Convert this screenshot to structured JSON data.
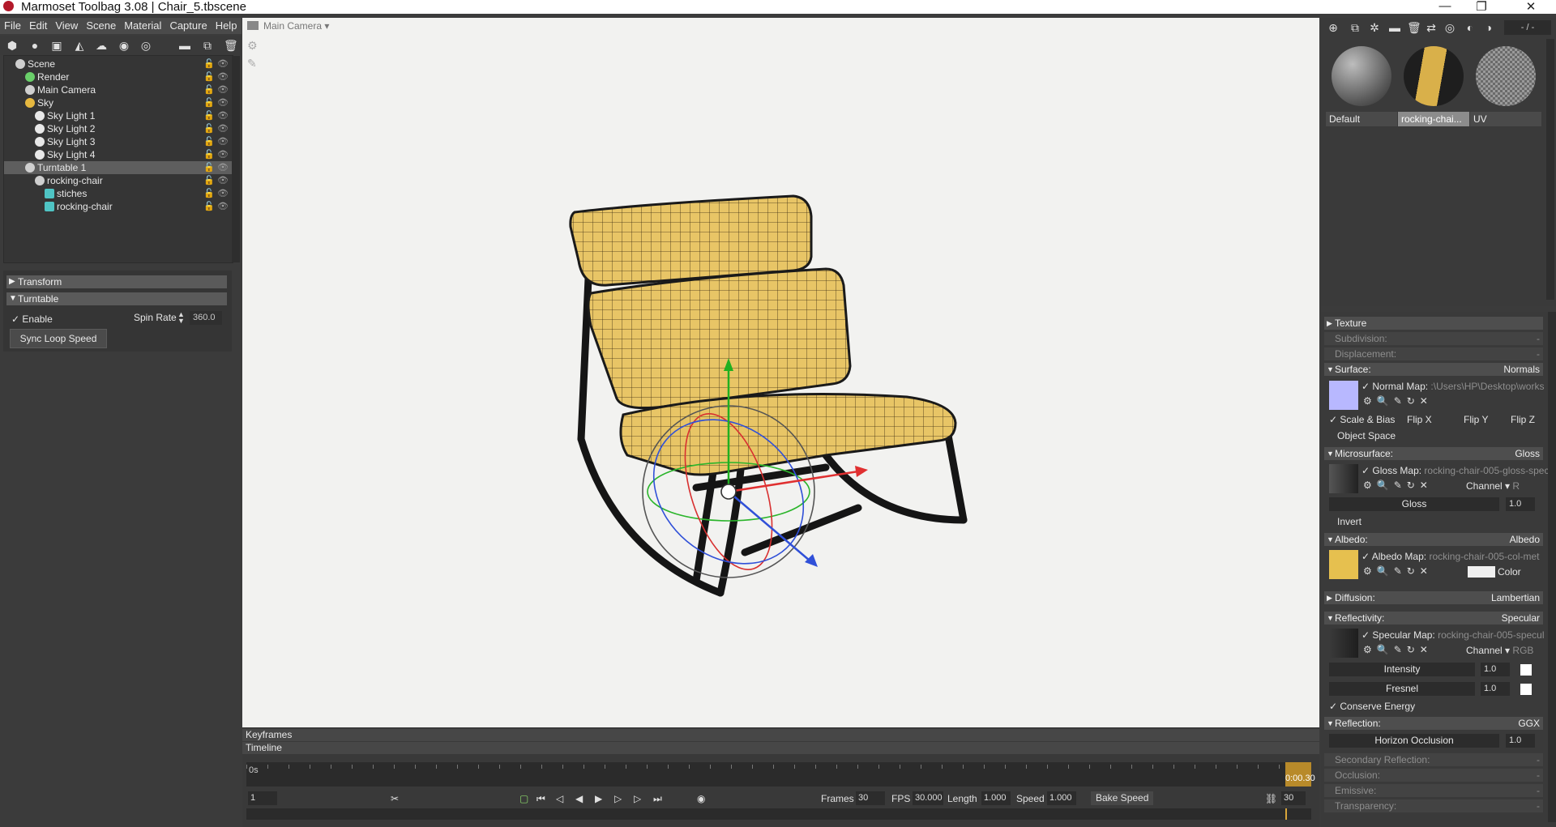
{
  "window": {
    "title": "Marmoset Toolbag 3.08  |  Chair_5.tbscene",
    "controls": [
      "—",
      "❐",
      "✕"
    ]
  },
  "menu": [
    "File",
    "Edit",
    "View",
    "Scene",
    "Material",
    "Capture",
    "Help"
  ],
  "scene_tree": [
    {
      "label": "Scene",
      "depth": 0,
      "icon": "scene-icon",
      "selected": false
    },
    {
      "label": "Render",
      "depth": 1,
      "icon": "render-icon",
      "selected": false
    },
    {
      "label": "Main Camera",
      "depth": 1,
      "icon": "camera-icon",
      "selected": false
    },
    {
      "label": "Sky",
      "depth": 1,
      "icon": "sky-icon",
      "selected": false
    },
    {
      "label": "Sky Light 1",
      "depth": 2,
      "icon": "light-icon",
      "selected": false
    },
    {
      "label": "Sky Light 2",
      "depth": 2,
      "icon": "light-icon",
      "selected": false
    },
    {
      "label": "Sky Light 3",
      "depth": 2,
      "icon": "light-icon",
      "selected": false
    },
    {
      "label": "Sky Light 4",
      "depth": 2,
      "icon": "light-icon",
      "selected": false
    },
    {
      "label": "Turntable 1",
      "depth": 1,
      "icon": "turntable-icon",
      "selected": true
    },
    {
      "label": "rocking-chair",
      "depth": 2,
      "icon": "object-icon",
      "selected": false
    },
    {
      "label": "stiches",
      "depth": 3,
      "icon": "mesh-icon",
      "selected": false
    },
    {
      "label": "rocking-chair",
      "depth": 3,
      "icon": "mesh-icon",
      "selected": false
    }
  ],
  "left_props": {
    "transform_label": "Transform",
    "turntable_label": "Turntable",
    "enable_label": "Enable",
    "enable_checked": true,
    "spin_rate_label": "Spin Rate",
    "spin_rate_value": "360.0",
    "sync_button": "Sync Loop Speed"
  },
  "viewport": {
    "camera_label": "Main Camera",
    "background": "#f2f2f0"
  },
  "timeline": {
    "keyframes_label": "Keyframes",
    "timeline_label": "Timeline",
    "start_label": "0s",
    "end_label": "0:00.30",
    "current_frame": "1",
    "frames_label": "Frames",
    "frames_value": "30",
    "fps_label": "FPS",
    "fps_value": "30.000",
    "length_label": "Length",
    "length_value": "1.000",
    "speed_label": "Speed",
    "speed_value": "1.000",
    "bake_speed_label": "Bake Speed",
    "loop_value": "30"
  },
  "right_toolbar": {
    "counter": "- / -"
  },
  "materials": [
    {
      "name": "Default",
      "selected": false
    },
    {
      "name": "rocking-chai...",
      "selected": true
    },
    {
      "name": "UV",
      "selected": false
    }
  ],
  "material_props": {
    "texture": "Texture",
    "subdivision": "Subdivision:",
    "displacement": "Displacement:",
    "dash": "-",
    "surface": {
      "label": "Surface:",
      "value": "Normals",
      "map_label": "Normal Map:",
      "map_path": ":\\Users\\HP\\Desktop\\works",
      "scale_bias": "Scale & Bias",
      "flip_x": "Flip X",
      "flip_y": "Flip Y",
      "flip_z": "Flip Z",
      "object_space": "Object Space"
    },
    "microsurface": {
      "label": "Microsurface:",
      "value": "Gloss",
      "map_label": "Gloss Map:",
      "map_path": "rocking-chair-005-gloss-spec",
      "channel_label": "Channel",
      "channel_value": "R",
      "slider_label": "Gloss",
      "slider_value": "1.0",
      "invert": "Invert"
    },
    "albedo": {
      "label": "Albedo:",
      "value": "Albedo",
      "map_label": "Albedo Map:",
      "map_path": "rocking-chair-005-col-met",
      "color_label": "Color"
    },
    "diffusion": {
      "label": "Diffusion:",
      "value": "Lambertian"
    },
    "reflectivity": {
      "label": "Reflectivity:",
      "value": "Specular",
      "map_label": "Specular Map:",
      "map_path": "rocking-chair-005-specul",
      "channel_label": "Channel",
      "channel_value": "RGB",
      "intensity_label": "Intensity",
      "intensity_value": "1.0",
      "fresnel_label": "Fresnel",
      "fresnel_value": "1.0",
      "conserve": "Conserve Energy"
    },
    "reflection": {
      "label": "Reflection:",
      "value": "GGX",
      "horizon_label": "Horizon Occlusion",
      "horizon_value": "1.0"
    },
    "secondary_reflection": "Secondary Reflection:",
    "occlusion": "Occlusion:",
    "emissive": "Emissive:",
    "transparency": "Transparency:"
  },
  "colors": {
    "chair_fabric": "#e8c566",
    "chair_frame": "#1a1a1a",
    "selected_row": "#5e5e5e",
    "normal_swatch": "#b8b8ff",
    "albedo_swatch": "#e6c04f"
  }
}
